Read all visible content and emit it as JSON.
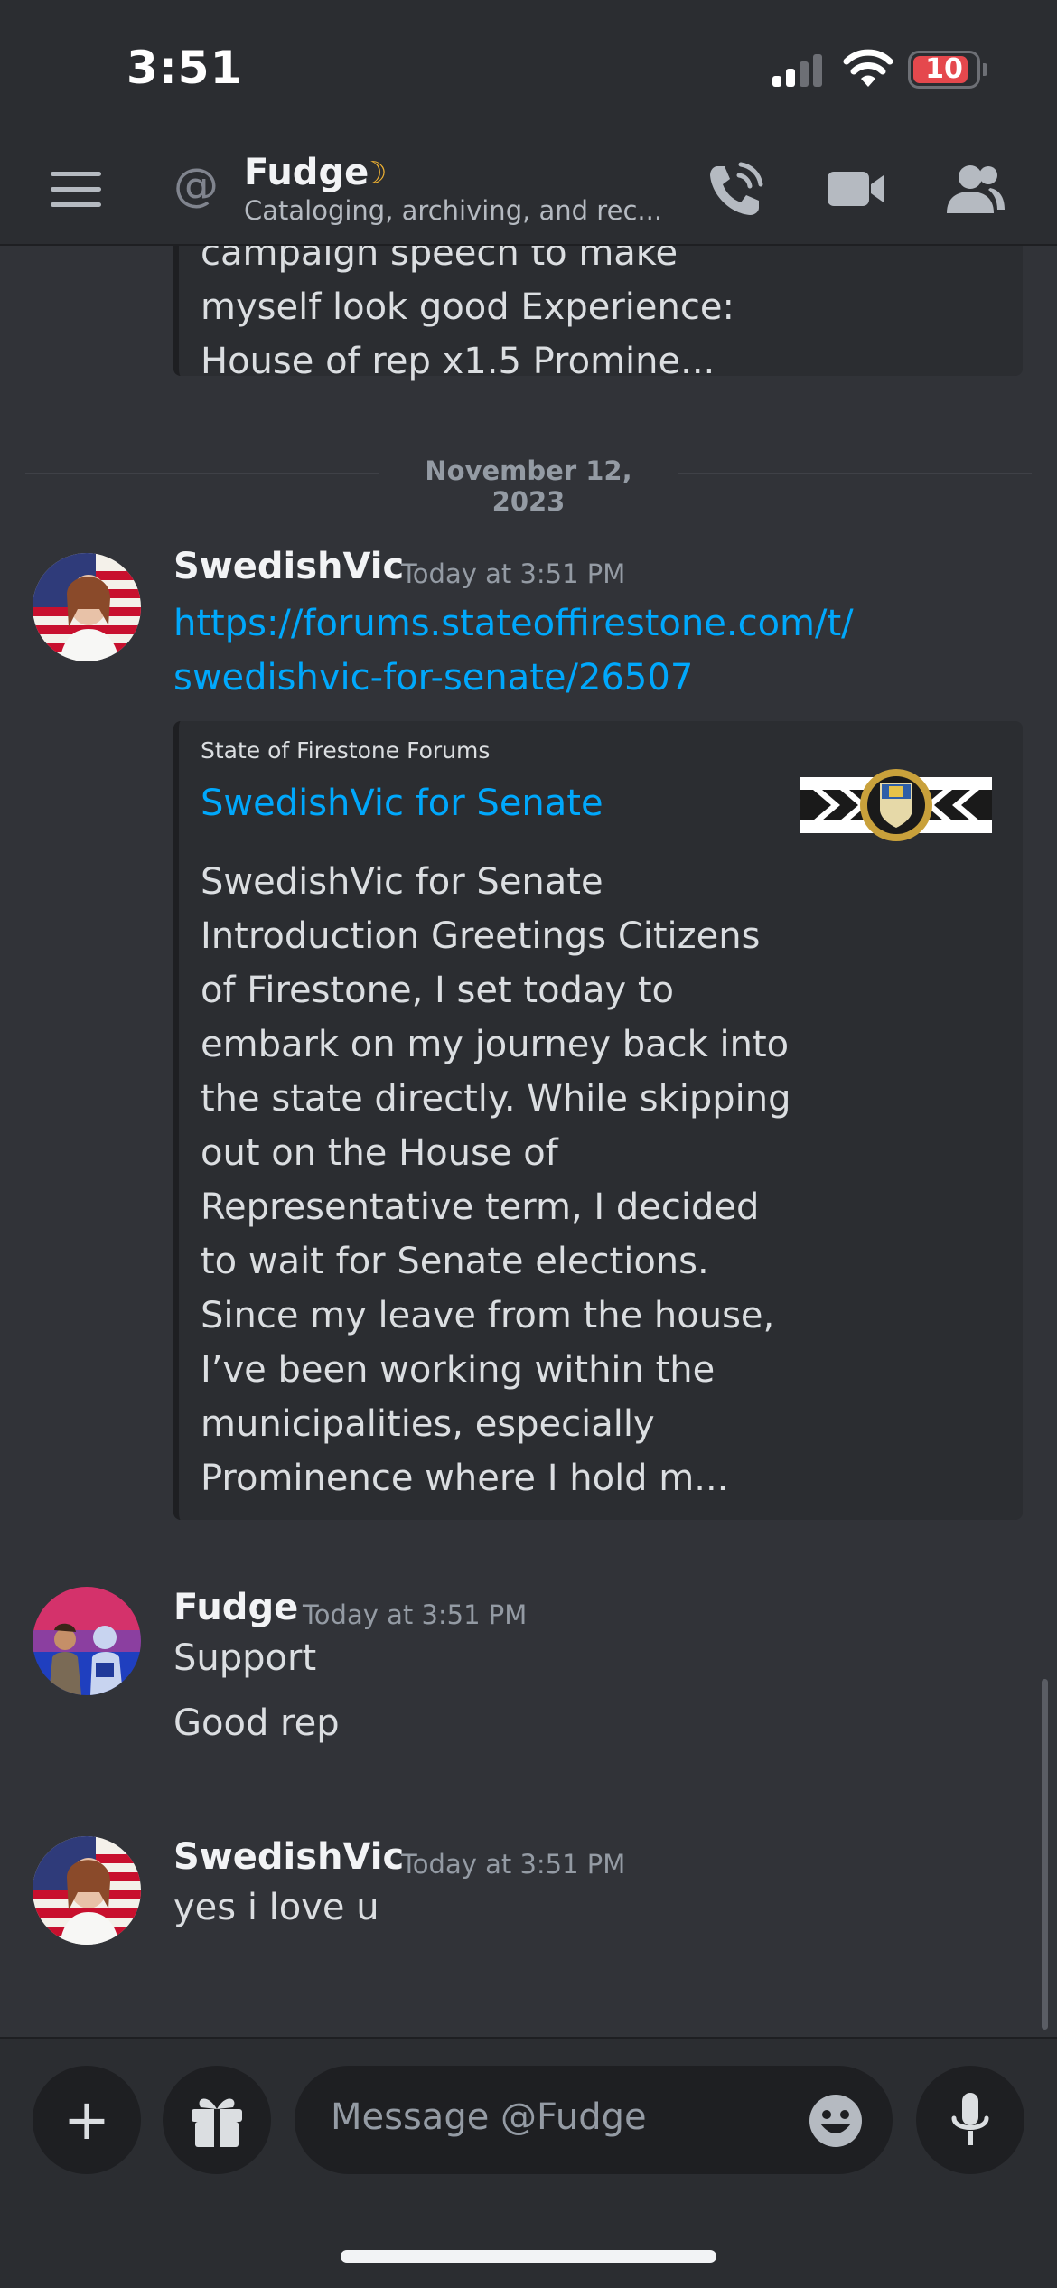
{
  "status_bar": {
    "time": "3:51",
    "battery_level": "10"
  },
  "header": {
    "channel_name": "Fudge",
    "channel_subtitle": "Cataloging, archiving, and rec..."
  },
  "previous_embed_text": [
    "campaign speech to make",
    "myself look good  Experience:",
    "House of rep x1.5  Promine..."
  ],
  "date_divider": "November 12, 2023",
  "messages": [
    {
      "author": "SwedishVic",
      "timestamp": "Today at 3:51 PM",
      "link_lines": [
        "https://forums.stateoffirestone.com/t/",
        "swedishvic-for-senate/26507"
      ],
      "embed": {
        "provider": "State of Firestone Forums",
        "title": "SwedishVic for Senate",
        "description_lines": [
          "SwedishVic for Senate",
          "Introduction  Greetings Citizens",
          "of Firestone,  I set today to",
          "embark on my journey back into",
          "the state directly. While skipping",
          "out on the House of",
          "Representative term, I decided",
          "to wait for Senate elections.",
          "Since my leave from the house,",
          "I’ve been working within the",
          "municipalities, especially",
          "Prominence where I hold m..."
        ]
      }
    },
    {
      "author": "Fudge",
      "timestamp": "Today at 3:51 PM",
      "lines": [
        "Support",
        "Good rep"
      ]
    },
    {
      "author": "SwedishVic",
      "timestamp": "Today at 3:51 PM",
      "lines": [
        "yes i love u"
      ]
    }
  ],
  "composer": {
    "placeholder": "Message @Fudge"
  },
  "colors": {
    "link": "#00a8fc",
    "background": "#313338",
    "surface": "#2b2d31",
    "status_moon": "#f0b232"
  }
}
